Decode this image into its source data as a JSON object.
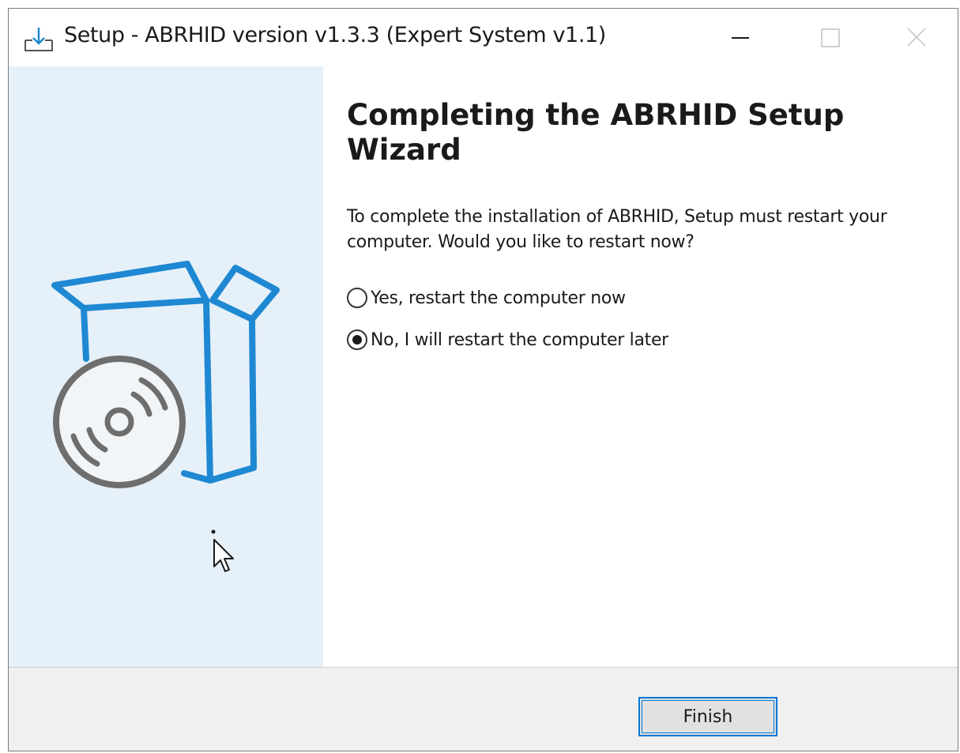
{
  "window": {
    "title": "Setup - ABRHID version v1.3.3 (Expert System v1.1)",
    "icon": "setup-download-icon",
    "controls": {
      "minimize_icon": "minimize-icon",
      "maximize_icon": "maximize-icon",
      "close_icon": "close-icon"
    }
  },
  "sidepanel": {
    "illustration": "box-with-disc-icon"
  },
  "main": {
    "heading": "Completing the ABRHID Setup Wizard",
    "description": "To complete the installation of ABRHID, Setup must restart your computer. Would you like to restart now?",
    "options": [
      {
        "label": "Yes, restart the computer now",
        "checked": false
      },
      {
        "label": "No, I will restart the computer later",
        "checked": true
      }
    ]
  },
  "footer": {
    "finish_label": "Finish"
  },
  "colors": {
    "accent": "#0078d7",
    "illustration_blue": "#1e88d2",
    "disc_gray": "#6e6e6e",
    "sidepanel_bg": "#e6f0f9",
    "footer_bg": "#f0f0f0"
  }
}
